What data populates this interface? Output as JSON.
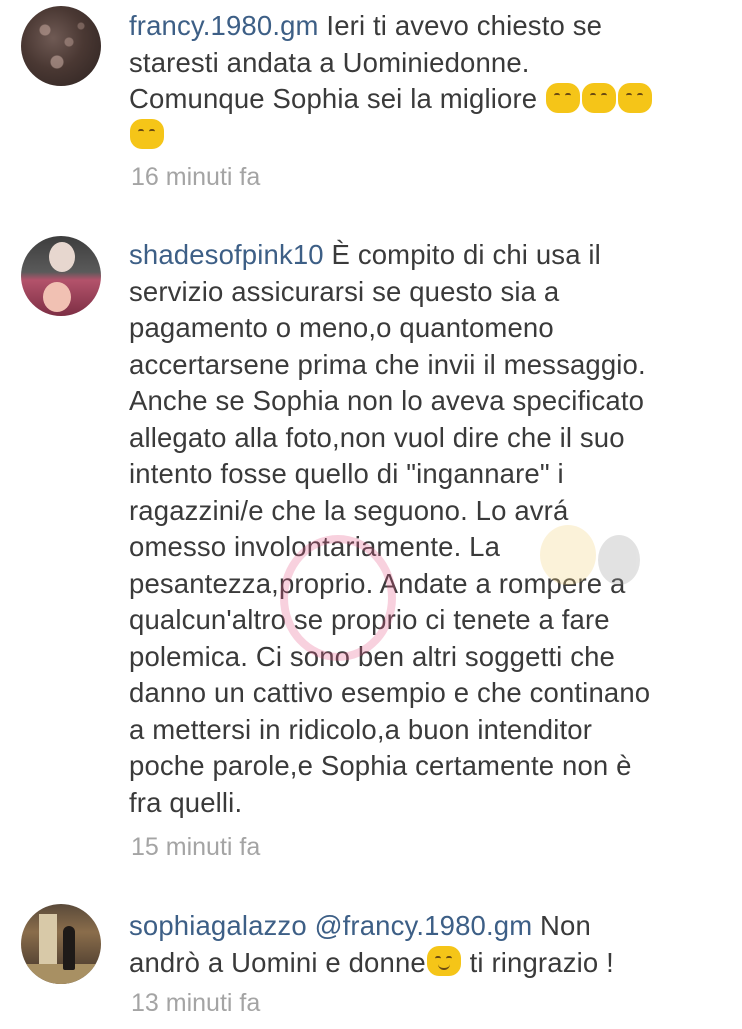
{
  "comments": [
    {
      "username": "francy.1980.gm",
      "lines": [
        "Ieri ti avevo chiesto se",
        "staresti andata a Uominiedonne.",
        "Comunque Sophia sei la migliore"
      ],
      "time": "16 minuti fa",
      "emoji_names": [
        "blush-emoji",
        "blush-emoji",
        "blush-emoji",
        "blush-emoji"
      ]
    },
    {
      "username": "shadesofpink10",
      "first_line_rest": "È compito di chi usa il",
      "lines": [
        "servizio assicurarsi se questo sia a",
        "pagamento o meno,o quantomeno",
        "accertarsene prima che invii il messaggio.",
        "Anche se Sophia non lo aveva specificato",
        "allegato alla foto,non vuol dire che il suo",
        "intento fosse quello di \"ingannare\" i",
        "ragazzini/e che la seguono. Lo avrá",
        "omesso involontariamente. La",
        "pesantezza,proprio. Andate a rompere a",
        "qualcun'altro se proprio ci tenete a fare",
        "polemica. Ci sono ben altri soggetti che",
        "danno un cattivo esempio e che continano",
        "a mettersi in ridicolo,a buon intenditor",
        "poche parole,e Sophia certamente non è",
        "fra quelli."
      ],
      "time": "15 minuti fa"
    },
    {
      "username": "sophiagalazzo",
      "mention": "@francy.1980.gm",
      "first_line_rest": "Non",
      "line2": "andrò a Uomini e donne",
      "line2_end": "ti ringrazio !",
      "time": "13 minuti fa",
      "emoji_names": [
        "smiling-emoji"
      ]
    }
  ],
  "colors": {
    "username": "#3d5f86",
    "text": "#3a3a3a",
    "timestamp": "#a4a4a4",
    "emoji": "#f5c518"
  }
}
